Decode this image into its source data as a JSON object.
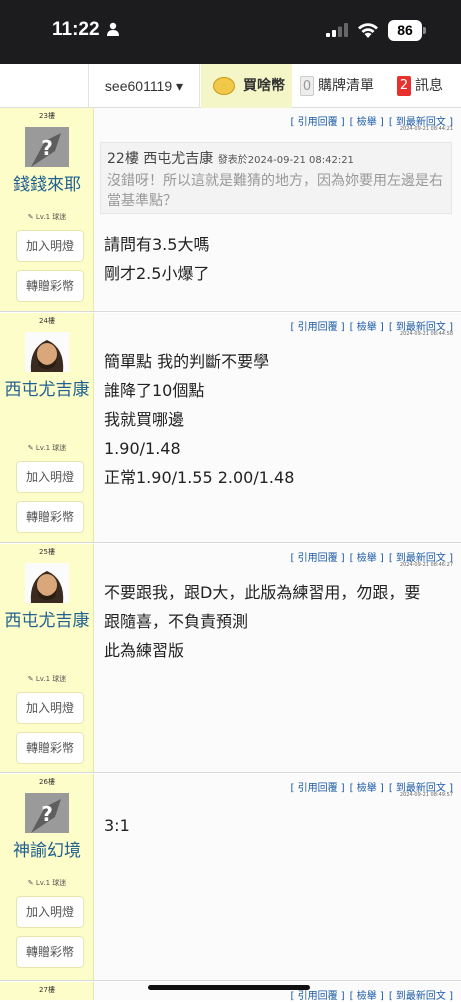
{
  "status": {
    "time": "11:22",
    "battery": "86"
  },
  "nav": {
    "user": "see601119 ▾",
    "coin_label": "買啥幣",
    "cart_count": "0",
    "cart_label": "購牌清單",
    "msg_count": "2",
    "msg_label": "訊息"
  },
  "tools": {
    "quote": "[ 引用回覆 ]",
    "report": "[ 檢舉 ]",
    "latest": "[ 到最新回文 ]"
  },
  "posts": [
    {
      "floor": "23樓",
      "user": "錢錢來耶",
      "level": "✎ Lv.1 球迷",
      "btn_follow": "加入明燈",
      "btn_gift": "轉贈彩幣",
      "time": "2024-09-21 08:44:21",
      "quote_header": "22樓 西屯尤吉康",
      "quote_time": "發表於2024-09-21 08:42:21",
      "quote_body": "沒錯呀！所以這就是難猜的地方，因為妳要用左邊是右當基準點？",
      "lines": [
        "請問有3.5大嗎",
        "剛才2.5小爆了"
      ]
    },
    {
      "floor": "24樓",
      "user": "西屯尤吉康",
      "level": "✎ Lv.1 球迷",
      "btn_follow": "加入明燈",
      "btn_gift": "轉贈彩幣",
      "time": "2024-09-21 08:44:58",
      "lines": [
        "簡單點 我的判斷不要學",
        "誰降了10個點",
        "我就買哪邊",
        "1.90/1.48",
        "正常1.90/1.55 2.00/1.48"
      ]
    },
    {
      "floor": "25樓",
      "user": "西屯尤吉康",
      "level": "✎ Lv.1 球迷",
      "btn_follow": "加入明燈",
      "btn_gift": "轉贈彩幣",
      "time": "2024-09-21 08:46:27",
      "lines": [
        "不要跟我，跟D大，此版為練習用，勿跟，要",
        "跟隨喜，不負責預測",
        "此為練習版"
      ]
    },
    {
      "floor": "26樓",
      "user": "神諭幻境",
      "level": "✎ Lv.1 球迷",
      "btn_follow": "加入明燈",
      "btn_gift": "轉贈彩幣",
      "time": "2024-09-21 08:49:57",
      "lines": [
        "3:1"
      ]
    },
    {
      "floor": "27樓"
    }
  ]
}
